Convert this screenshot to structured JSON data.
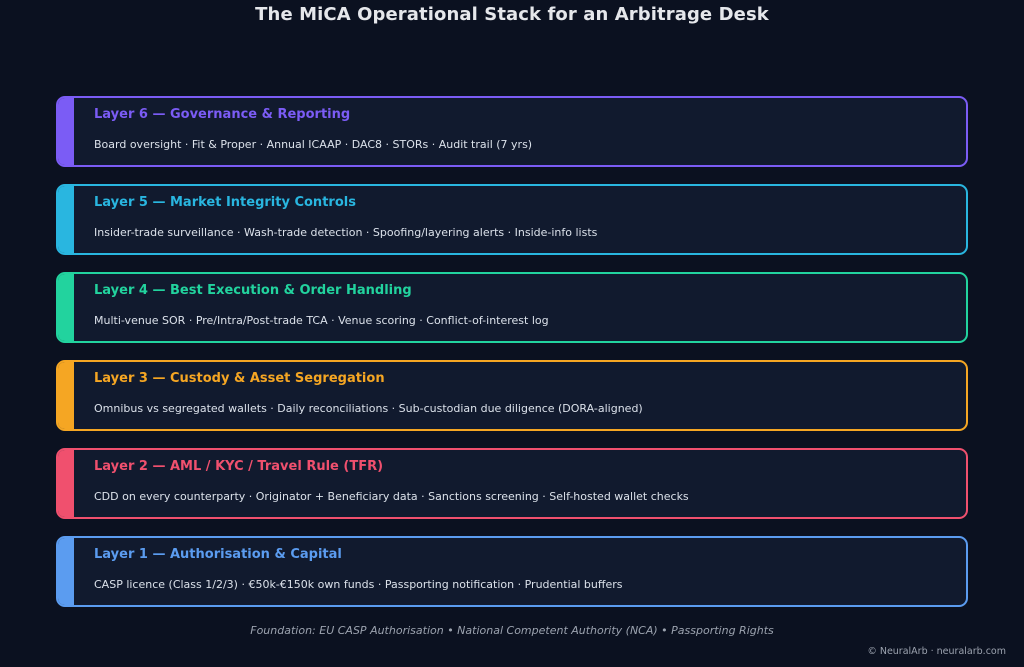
{
  "title": "The MiCA Operational Stack for an Arbitrage Desk",
  "layers": [
    {
      "title": "Layer 6 — Governance & Reporting",
      "description": "Board oversight · Fit & Proper · Annual ICAAP · DAC8 · STORs · Audit trail (7 yrs)",
      "color": "#7b5cf5"
    },
    {
      "title": "Layer 5 — Market Integrity Controls",
      "description": "Insider-trade surveillance · Wash-trade detection · Spoofing/layering alerts · Inside-info lists",
      "color": "#29b6e0"
    },
    {
      "title": "Layer 4 — Best Execution & Order Handling",
      "description": "Multi-venue SOR · Pre/Intra/Post-trade TCA · Venue scoring · Conflict-of-interest log",
      "color": "#22d39e"
    },
    {
      "title": "Layer 3 — Custody & Asset Segregation",
      "description": "Omnibus vs segregated wallets · Daily reconciliations · Sub-custodian due diligence (DORA-aligned)",
      "color": "#f5a623"
    },
    {
      "title": "Layer 2 — AML / KYC / Travel Rule (TFR)",
      "description": "CDD on every counterparty · Originator + Beneficiary data · Sanctions screening · Self-hosted wallet checks",
      "color": "#f0506e"
    },
    {
      "title": "Layer 1 — Authorisation & Capital",
      "description": "CASP licence (Class 1/2/3) · €50k-€150k own funds · Passporting notification · Prudential buffers",
      "color": "#5b9cf0"
    }
  ],
  "foundation": "Foundation: EU CASP Authorisation • National Competent Authority (NCA) • Passporting Rights",
  "copyright": "© NeuralArb · neuralarb.com"
}
